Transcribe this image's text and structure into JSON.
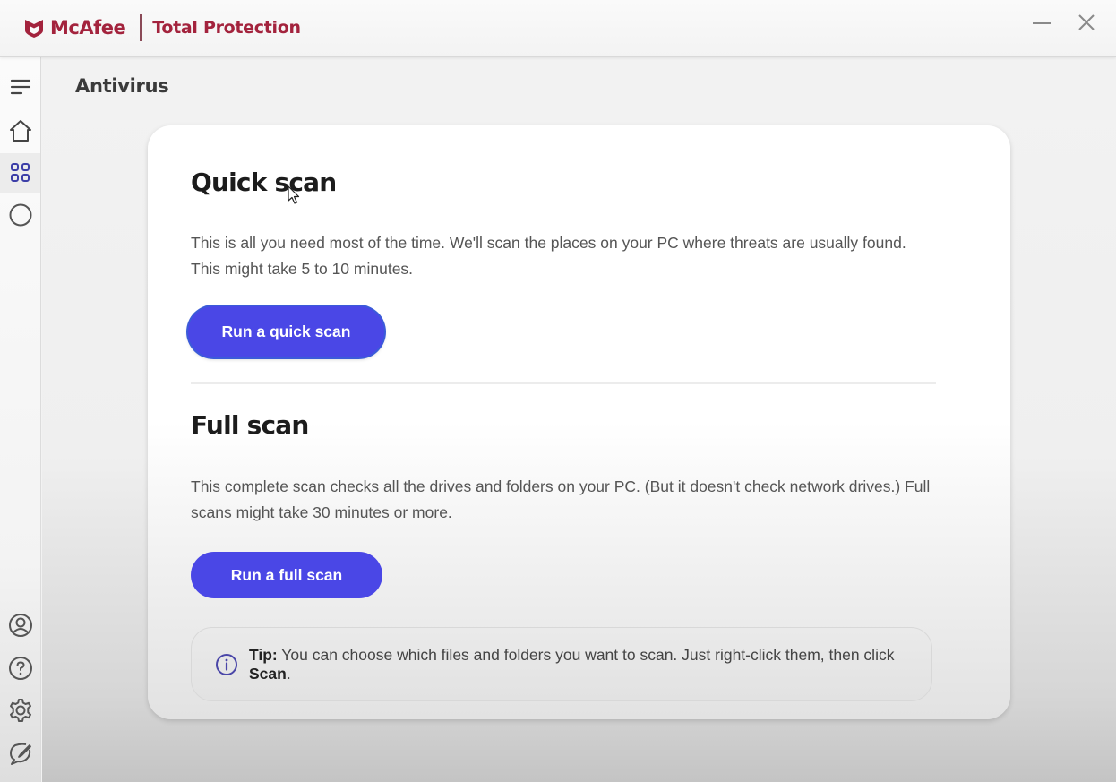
{
  "titlebar": {
    "brand": "McAfee",
    "product": "Total Protection",
    "minimize_label": "Minimize",
    "close_label": "Close"
  },
  "sidebar": {
    "items": [
      {
        "id": "menu",
        "icon": "hamburger-menu-icon",
        "label": "Menu",
        "active": false
      },
      {
        "id": "home",
        "icon": "home-icon",
        "label": "Home",
        "active": false
      },
      {
        "id": "apps",
        "icon": "grid-icon",
        "label": "My protection",
        "active": true
      },
      {
        "id": "status",
        "icon": "circle-icon",
        "label": "Status",
        "active": false
      }
    ],
    "bottom_items": [
      {
        "id": "account",
        "icon": "user-icon",
        "label": "My account"
      },
      {
        "id": "help",
        "icon": "help-icon",
        "label": "Help"
      },
      {
        "id": "settings",
        "icon": "gear-icon",
        "label": "Settings"
      },
      {
        "id": "feedback",
        "icon": "feedback-icon",
        "label": "Feedback"
      }
    ]
  },
  "page": {
    "title": "Antivirus",
    "quick_scan": {
      "title": "Quick scan",
      "description": "This is all you need most of the time. We'll scan the places on your PC where threats are usually found. This might take 5 to 10 minutes.",
      "button": "Run a quick scan"
    },
    "full_scan": {
      "title": "Full scan",
      "description": "This complete scan checks all the drives and folders on your PC. (But it doesn't check network drives.) Full scans might take 30 minutes or more.",
      "button": "Run a full scan"
    },
    "tip": {
      "label": "Tip:",
      "text_before": " You can choose which files and folders you want to scan. Just right-click them, then click ",
      "emphasis": "Scan",
      "text_after": "."
    }
  },
  "colors": {
    "brand": "#a3233d",
    "primary_button": "#4a47e6",
    "active_icon": "#3d3fa8"
  }
}
